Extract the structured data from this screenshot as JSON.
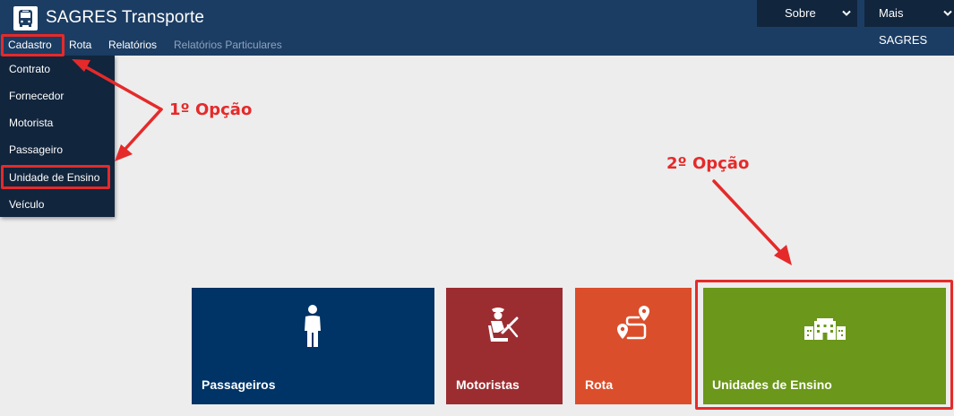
{
  "app": {
    "title": "SAGRES Transporte",
    "icon": "bus-icon"
  },
  "header": {
    "dropdowns": [
      {
        "label": "Sobre",
        "icon": "chevron-down-icon"
      },
      {
        "label": "Mais SAGRES",
        "icon": "chevron-down-icon"
      }
    ]
  },
  "menu": {
    "items": [
      {
        "label": "Cadastro",
        "active": true
      },
      {
        "label": "Rota"
      },
      {
        "label": "Relatórios"
      },
      {
        "label": "Relatórios Particulares",
        "disabled": true
      }
    ]
  },
  "submenu": {
    "items": [
      "Contrato",
      "Fornecedor",
      "Motorista",
      "Passageiro",
      "Unidade de Ensino",
      "Veículo"
    ]
  },
  "annotations": {
    "option1": "1º Opção",
    "option2": "2º Opção",
    "color": "#e52a2a"
  },
  "tiles": [
    {
      "label": "Passageiros",
      "icon": "person-icon",
      "color": "#003366"
    },
    {
      "label": "Motoristas",
      "icon": "driver-icon",
      "color": "#9b2d31"
    },
    {
      "label": "Rota",
      "icon": "route-icon",
      "color": "#db4e2b"
    },
    {
      "label": "Unidades de Ensino",
      "icon": "school-buildings-icon",
      "color": "#6b971a"
    }
  ]
}
